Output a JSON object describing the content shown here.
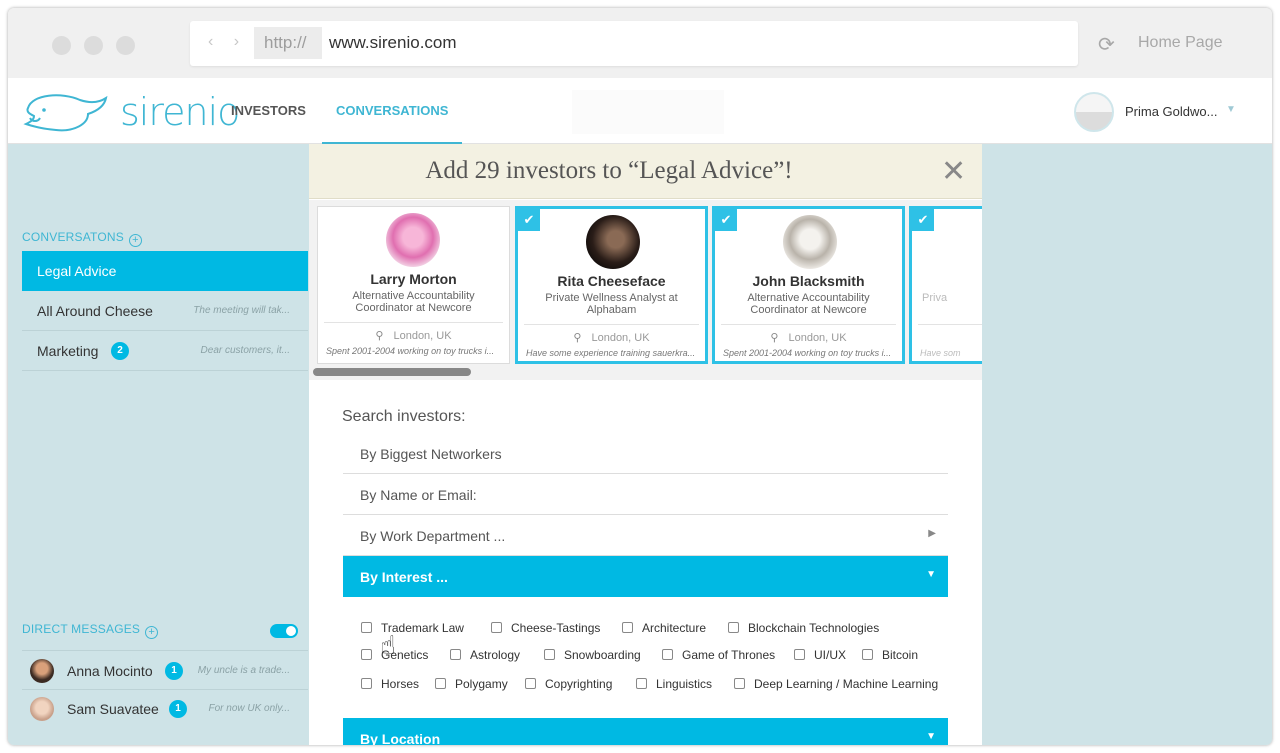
{
  "browser": {
    "protocol": "http://",
    "domain": "www.sirenio.com",
    "home_label": "Home Page"
  },
  "app": {
    "logo_text": "sirenio",
    "nav": [
      "INVESTORS",
      "CONVERSATIONS"
    ],
    "active_nav": "CONVERSATIONS",
    "user_name": "Prima Goldwo..."
  },
  "sidebar": {
    "conversations_title": "CONVERSATONS",
    "conversations": [
      {
        "name": "Legal Advice",
        "preview": "",
        "badge": ""
      },
      {
        "name": "All Around Cheese",
        "preview": "The meeting will tak...",
        "badge": ""
      },
      {
        "name": "Marketing",
        "preview": "Dear customers, it...",
        "badge": "2"
      }
    ],
    "dm_title": "DIRECT MESSAGES",
    "dms": [
      {
        "name": "Anna Mocinto",
        "preview": "My uncle is a trade...",
        "badge": "1"
      },
      {
        "name": "Sam Suavatee",
        "preview": "For now UK only...",
        "badge": "1"
      }
    ]
  },
  "modal": {
    "title": "Add 29 investors to “Legal Advice”!",
    "close_label": "✕",
    "cards": [
      {
        "name": "Larry Morton",
        "role": "Alternative Accountability Coordinator at Newcore",
        "location": "London, UK",
        "note": "Spent 2001-2004 working on toy trucks i...",
        "selected": false
      },
      {
        "name": "Rita Cheeseface",
        "role": "Private Wellness Analyst at Alphabam",
        "location": "London, UK",
        "note": "Have some experience training sauerkra...",
        "selected": true
      },
      {
        "name": "John Blacksmith",
        "role": "Alternative Accountability Coordinator at Newcore",
        "location": "London, UK",
        "note": "Spent 2001-2004 working on toy trucks i...",
        "selected": true
      },
      {
        "name": "",
        "role": "Priva",
        "location": "",
        "note": "Have som",
        "selected": true
      }
    ],
    "search_label": "Search investors:",
    "filters": [
      {
        "label": "By Biggest Networkers",
        "state": "none"
      },
      {
        "label": "By Name or Email:",
        "state": "none"
      },
      {
        "label": "By Work Department ...",
        "state": "collapsed"
      },
      {
        "label": "By Interest ...",
        "state": "expanded"
      },
      {
        "label": "By Location",
        "state": "expanded"
      }
    ],
    "interests": [
      [
        "Trademark Law",
        "Cheese-Tastings",
        "Architecture",
        "Blockchain Technologies"
      ],
      [
        "Genetics",
        "Astrology",
        "Snowboarding",
        "Game of Thrones",
        "UI/UX",
        "Bitcoin"
      ],
      [
        "Horses",
        "Polygamy",
        "Copyrighting",
        "Linguistics",
        "Deep Learning / Machine Learning"
      ]
    ]
  },
  "colors": {
    "accent": "#00b9e3",
    "sidebar_bg": "#cee3e7",
    "modal_header_bg": "#f3f1e2"
  }
}
